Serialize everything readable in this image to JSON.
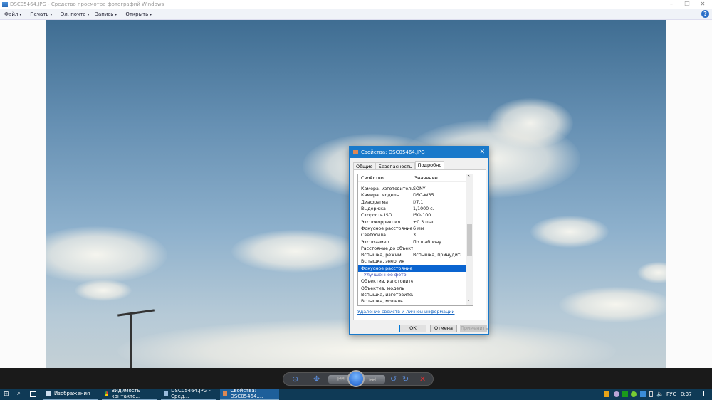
{
  "window": {
    "title": "DSC05464.JPG - Средство просмотра фотографий Windows",
    "minimize": "–",
    "restore": "❐",
    "close": "✕"
  },
  "menu": [
    "Файл",
    "Печать",
    "Эл. почта",
    "Запись",
    "Открыть"
  ],
  "help": "?",
  "dialog": {
    "title": "Свойства: DSC05464.JPG",
    "close": "✕",
    "tabs": [
      "Общие",
      "Безопасность",
      "Подробно"
    ],
    "selected_tab": "Подробно",
    "columns": [
      "Свойство",
      "Значение"
    ],
    "rows": [
      {
        "prop": "Камера, изготовитель",
        "val": "SONY"
      },
      {
        "prop": "Камера, модель",
        "val": "DSC-W35"
      },
      {
        "prop": "Диафрагма",
        "val": "f/7.1"
      },
      {
        "prop": "Выдержка",
        "val": "1/1000 с."
      },
      {
        "prop": "Скорость ISO",
        "val": "ISO-100"
      },
      {
        "prop": "Экспокоррекция",
        "val": "+0.3 шаг."
      },
      {
        "prop": "Фокусное расстояние",
        "val": "6 мм"
      },
      {
        "prop": "Светосила",
        "val": "3"
      },
      {
        "prop": "Экспозамер",
        "val": "По шаблону"
      },
      {
        "prop": "Расстояние до объекта",
        "val": ""
      },
      {
        "prop": "Вспышка, режим",
        "val": "Вспышка, принудите..."
      },
      {
        "prop": "Вспышка, энергия",
        "val": ""
      },
      {
        "prop": "Фокусное расстояние, э...",
        "val": ""
      }
    ],
    "group": "Улучшенное фото",
    "rows2": [
      {
        "prop": "Объектив, изготовитель",
        "val": ""
      },
      {
        "prop": "Объектив, модель",
        "val": ""
      },
      {
        "prop": "Вспышка, изготовитель",
        "val": ""
      },
      {
        "prop": "Вспышка, модель",
        "val": ""
      }
    ],
    "link": "Удаление свойств и личной информации",
    "ok": "ОК",
    "cancel": "Отмена",
    "apply": "Применить"
  },
  "taskbar": {
    "items": [
      "Изображения",
      "Видимость контакто...",
      "DSC05464.JPG - Сред...",
      "Свойства: DSC05464...."
    ],
    "lang": "РУС",
    "time": "0:37"
  }
}
